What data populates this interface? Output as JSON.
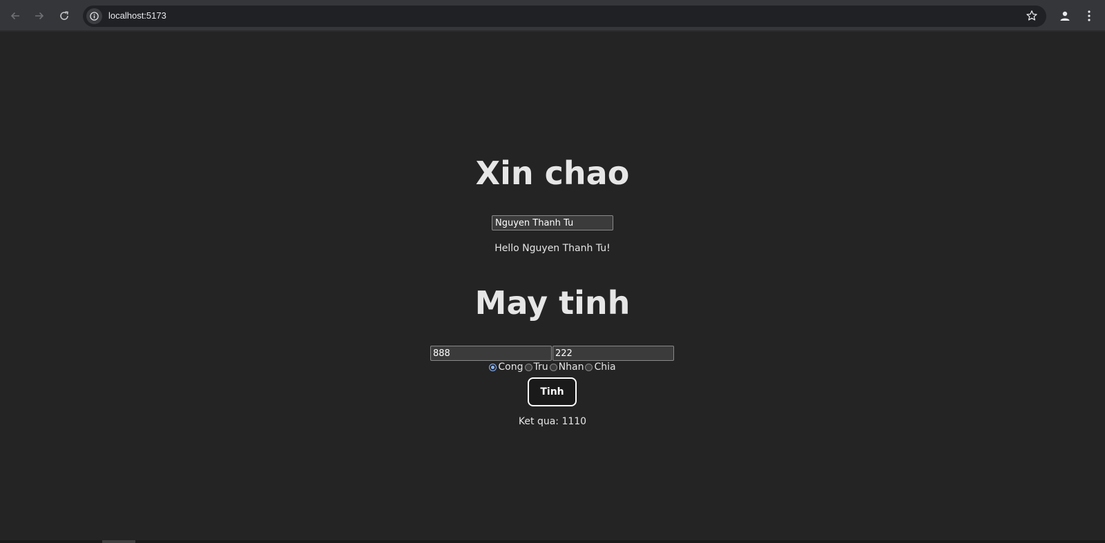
{
  "browser": {
    "url": "localhost:5173",
    "icons": {
      "back": "arrow-left-icon",
      "forward": "arrow-right-icon",
      "reload": "reload-icon",
      "info": "info-icon",
      "bookmark": "star-icon",
      "profile": "person-icon",
      "menu": "kebab-menu-icon"
    }
  },
  "greeting": {
    "title": "Xin chao",
    "name_value": "Nguyen Thanh Tu",
    "message": "Hello Nguyen Thanh Tu!"
  },
  "calculator": {
    "title": "May tinh",
    "operand_a": "888",
    "operand_b": "222",
    "operations": [
      {
        "label": "Cong",
        "checked": true
      },
      {
        "label": "Tru",
        "checked": false
      },
      {
        "label": "Nhan",
        "checked": false
      },
      {
        "label": "Chia",
        "checked": false
      }
    ],
    "button_label": "Tinh",
    "result": "Ket qua: 1110"
  },
  "colors": {
    "page_background": "#242424",
    "text": "#e6e6e6",
    "accent_radio": "#8ab4f8"
  }
}
